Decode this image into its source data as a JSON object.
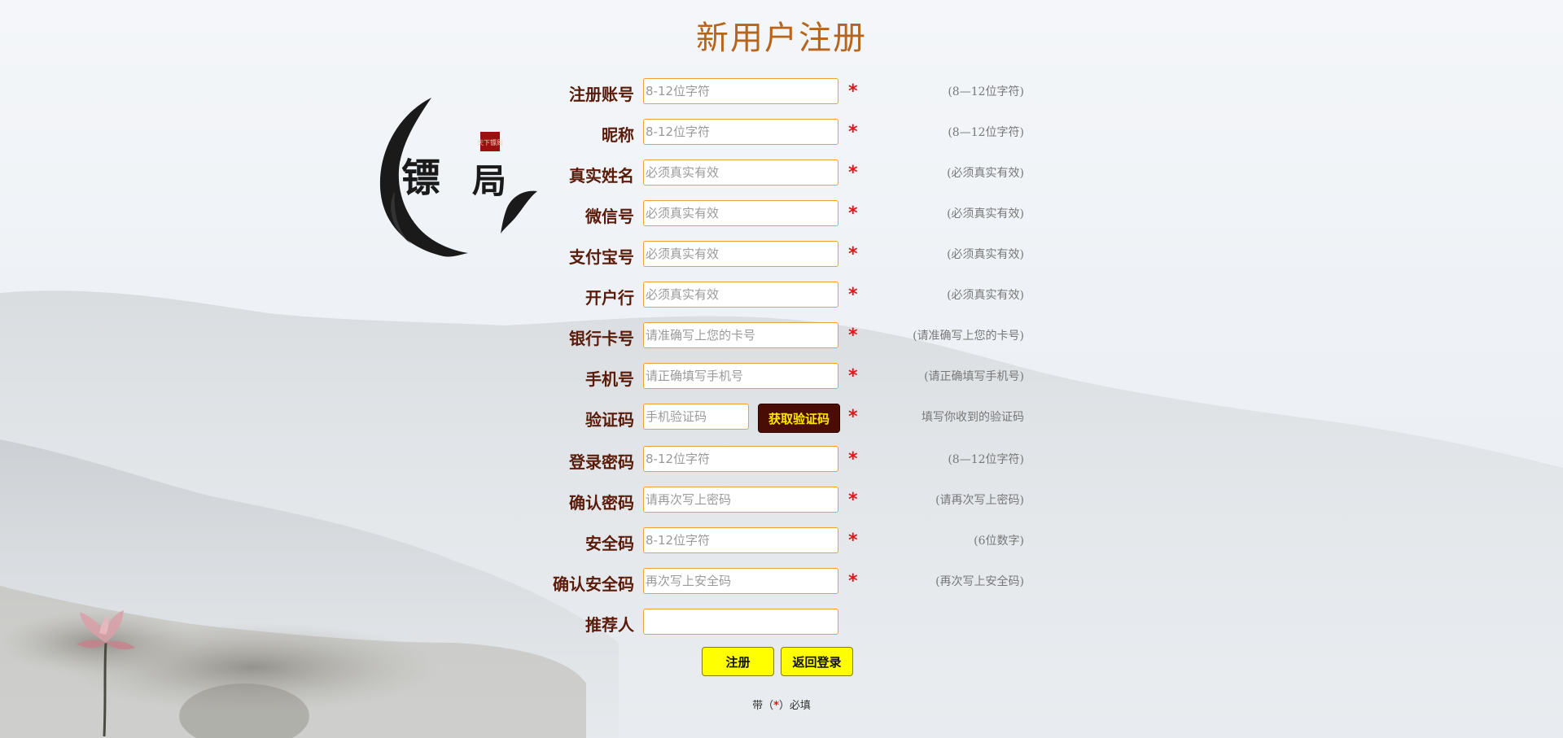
{
  "page": {
    "title": "新用户注册"
  },
  "fields": [
    {
      "label": "注册账号",
      "placeholder": "8-12位字符",
      "hint": "(8—12位字符)",
      "required": true
    },
    {
      "label": "昵称",
      "placeholder": "8-12位字符",
      "hint": "(8—12位字符)",
      "required": true
    },
    {
      "label": "真实姓名",
      "placeholder": "必须真实有效",
      "hint": "(必须真实有效)",
      "required": true
    },
    {
      "label": "微信号",
      "placeholder": "必须真实有效",
      "hint": "(必须真实有效)",
      "required": true
    },
    {
      "label": "支付宝号",
      "placeholder": "必须真实有效",
      "hint": "(必须真实有效)",
      "required": true
    },
    {
      "label": "开户行",
      "placeholder": "必须真实有效",
      "hint": "(必须真实有效)",
      "required": true
    },
    {
      "label": "银行卡号",
      "placeholder": "请准确写上您的卡号",
      "hint": "(请准确写上您的卡号)",
      "required": true
    },
    {
      "label": "手机号",
      "placeholder": "请正确填写手机号",
      "hint": "(请正确填写手机号)",
      "required": true
    },
    {
      "label": "验证码",
      "placeholder": "手机验证码",
      "hint": "填写你收到的验证码",
      "required": true,
      "button": "获取验证码"
    },
    {
      "label": "登录密码",
      "placeholder": "8-12位字符",
      "hint": "(8—12位字符)",
      "required": true
    },
    {
      "label": "确认密码",
      "placeholder": "请再次写上密码",
      "hint": "(请再次写上密码)",
      "required": true
    },
    {
      "label": "安全码",
      "placeholder": "8-12位字符",
      "hint": "(6位数字)",
      "required": true
    },
    {
      "label": "确认安全码",
      "placeholder": "再次写上安全码",
      "hint": "(再次写上安全码)",
      "required": true
    },
    {
      "label": "推荐人",
      "placeholder": "",
      "hint": "",
      "required": false
    }
  ],
  "required_mark": "*",
  "buttons": {
    "register": "注册",
    "back_login": "返回登录"
  },
  "footer_note": {
    "prefix": "带（",
    "mark": "*",
    "suffix": "）必填"
  },
  "logo": {
    "text_main": "镖",
    "text_second": "局",
    "seal": "天下镖局"
  },
  "colors": {
    "title": "#b5651d",
    "label": "#5a1c0a",
    "input_border": "#f0a030",
    "star": "#e0161b",
    "code_button_bg": "#4a0d05",
    "code_button_text": "#ffe800",
    "action_button_bg": "#ffff00"
  }
}
